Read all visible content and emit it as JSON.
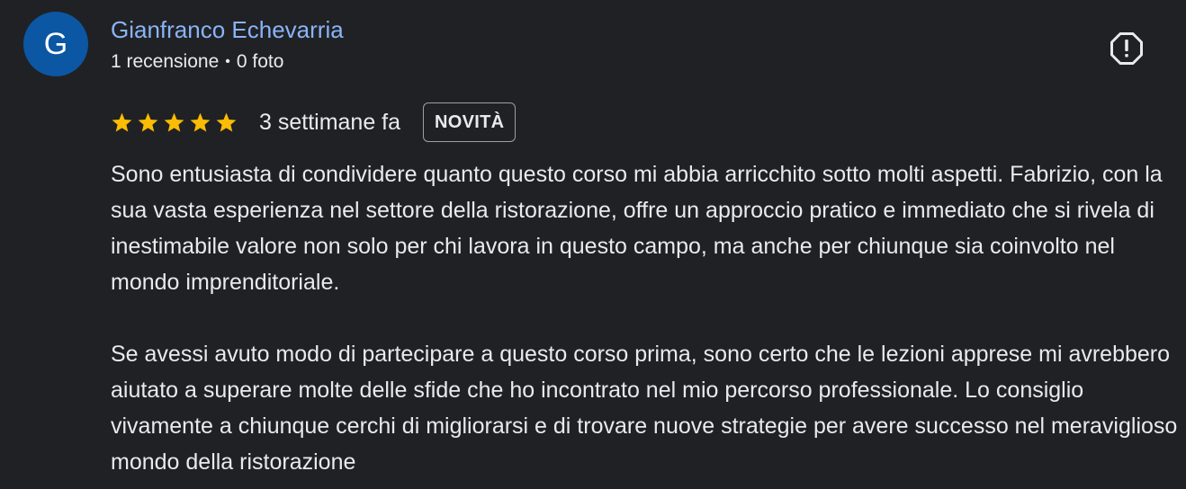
{
  "reviewer": {
    "initial": "G",
    "name": "Gianfranco Echevarria",
    "reviews_count": "1 recensione",
    "separator": "•",
    "photos_count": "0 foto",
    "avatar_color": "#0b57a4"
  },
  "rating": {
    "stars": 5,
    "max_stars": 5,
    "star_color": "#fbbc04",
    "time": "3 settimane fa",
    "badge": "NOVITÀ"
  },
  "review": {
    "paragraphs": [
      "Sono entusiasta di condividere quanto questo corso mi abbia arricchito sotto molti aspetti. Fabrizio, con la sua vasta esperienza nel settore della ristorazione, offre un approccio pratico e immediato che si rivela di inestimabile valore non solo per chi lavora in questo campo, ma anche per chiunque sia coinvolto nel mondo imprenditoriale.",
      "Se avessi avuto modo di partecipare a questo corso prima, sono certo che le lezioni apprese mi avrebbero aiutato a superare molte delle sfide che ho incontrato nel mio percorso professionale. Lo consiglio vivamente a chiunque cerchi di migliorarsi e di trovare nuove strategie per avere successo nel meraviglioso mondo della ristorazione"
    ]
  },
  "icons": {
    "report": "report-icon",
    "star": "star-icon"
  }
}
